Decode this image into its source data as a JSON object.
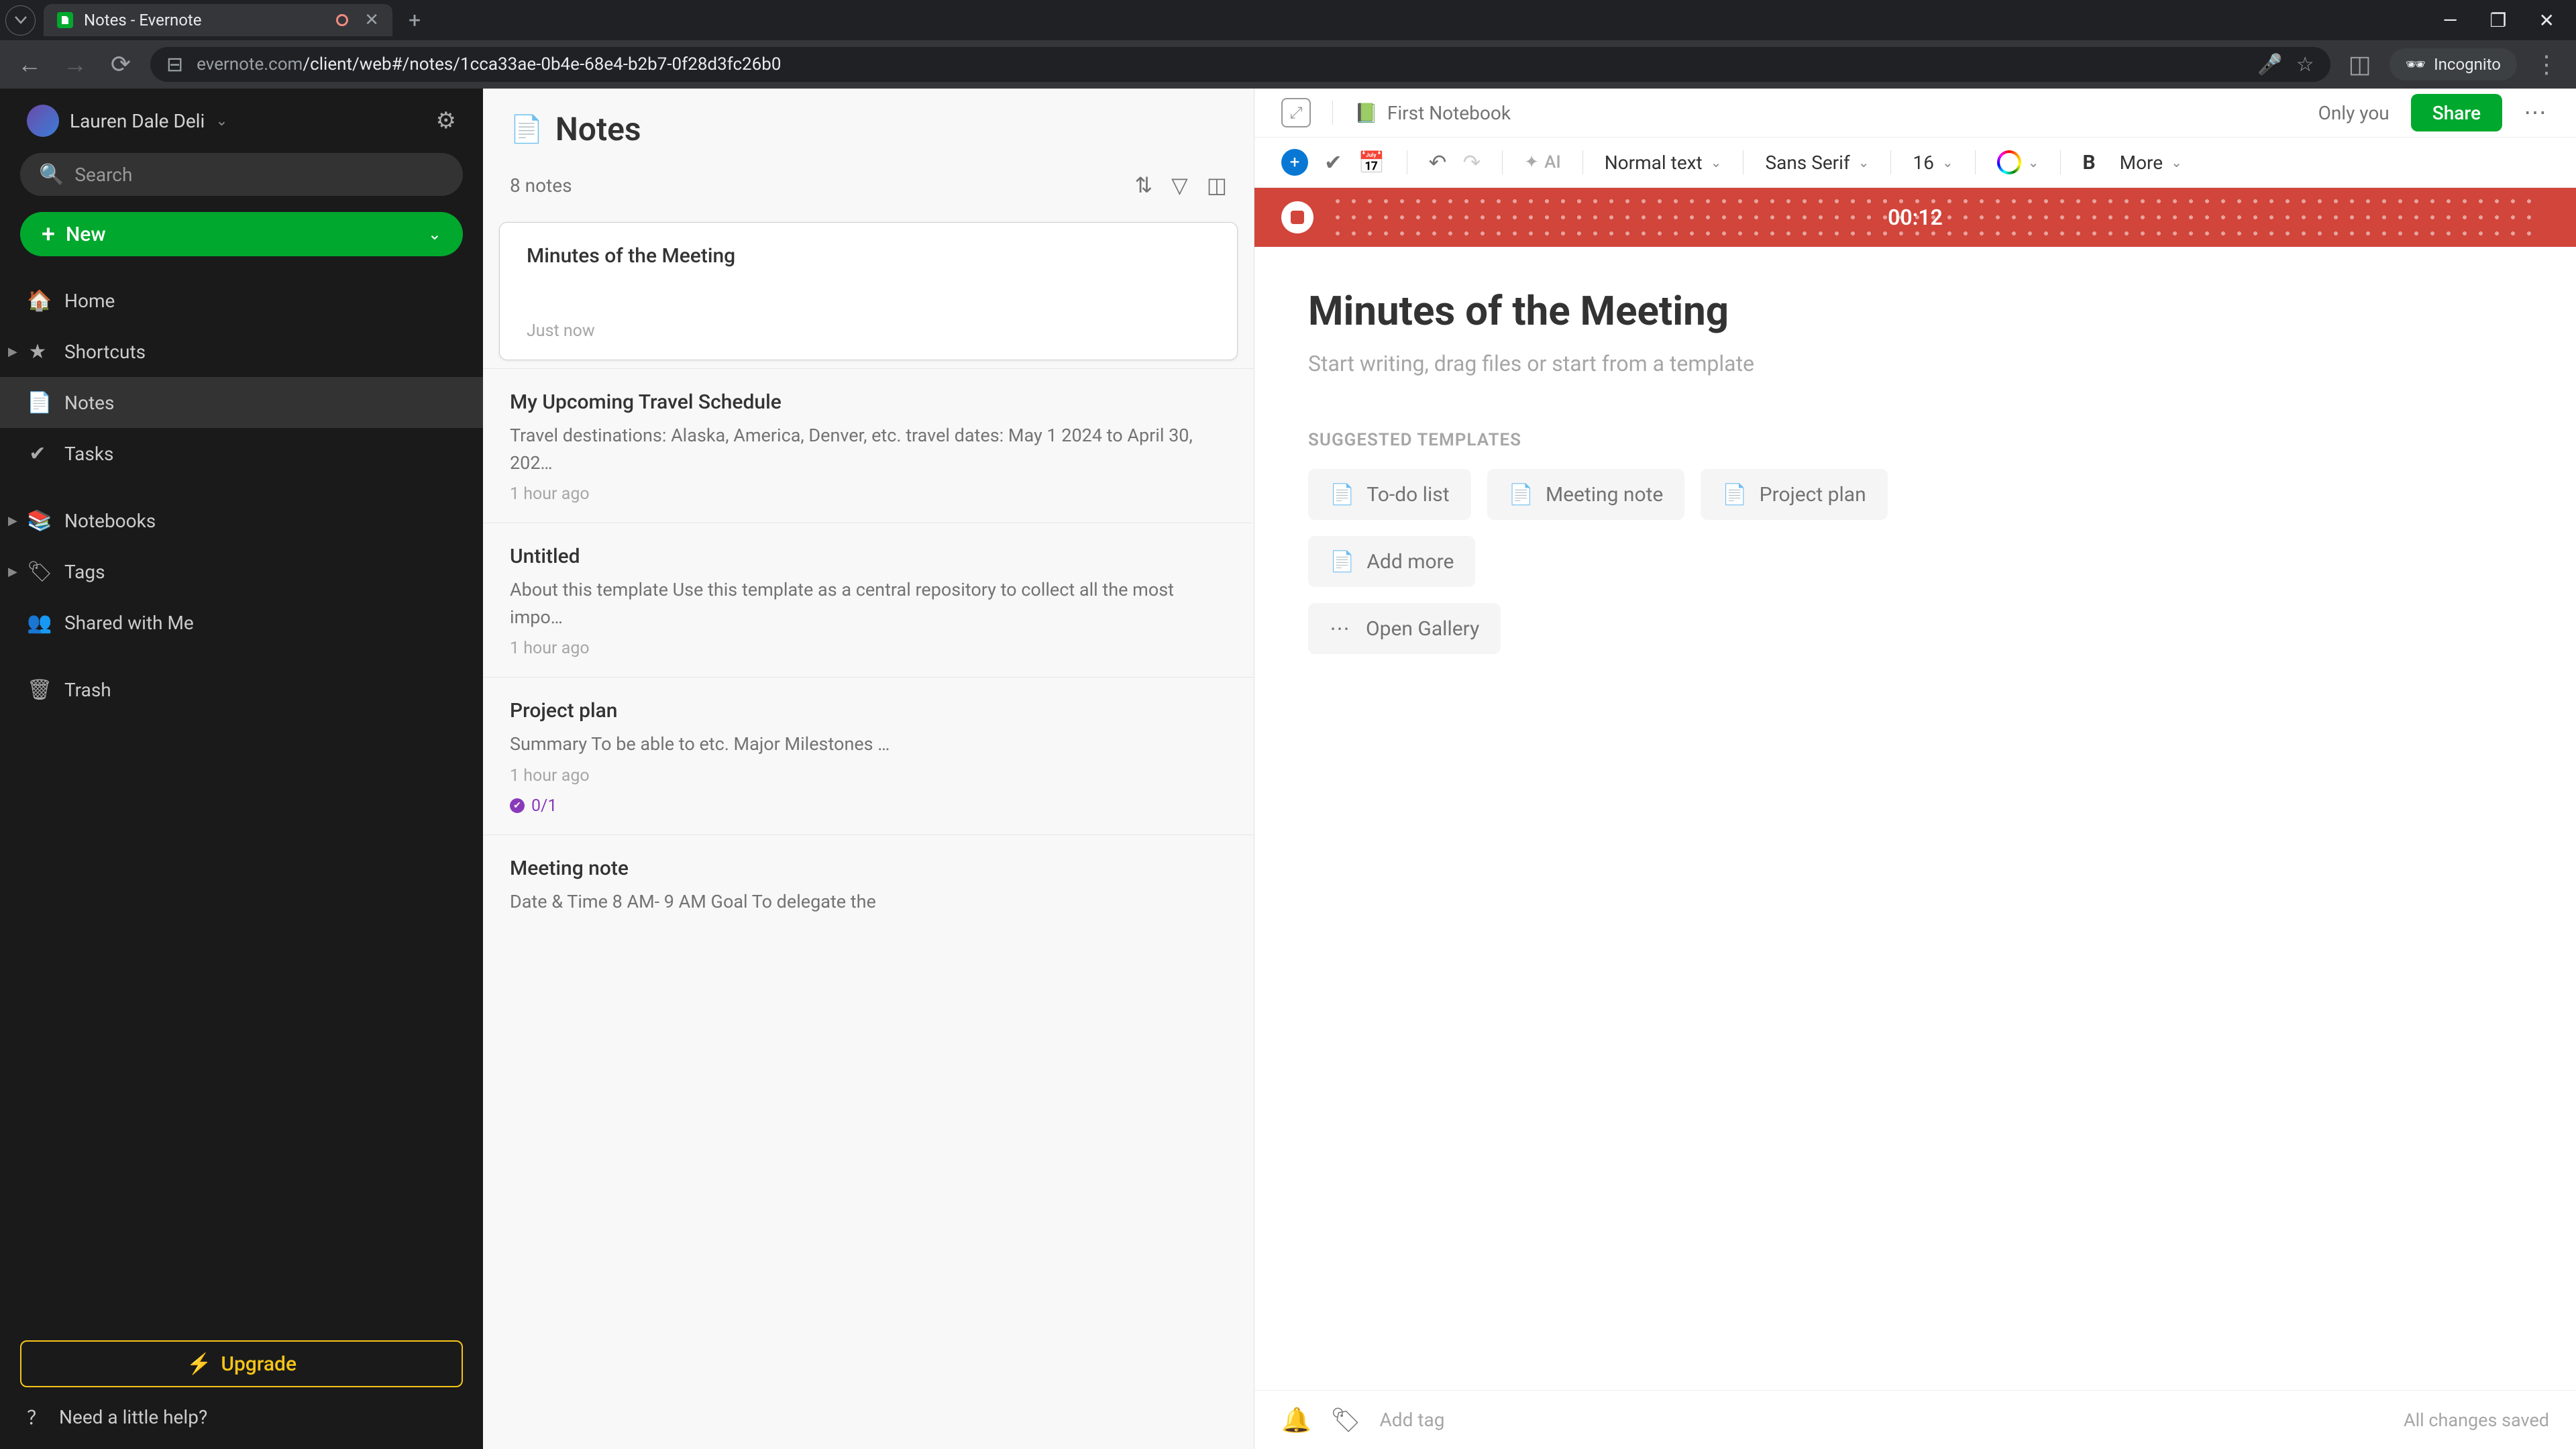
{
  "browser": {
    "tab_title": "Notes - Evernote",
    "url_display": "evernote.com/client/web#/notes/1cca33ae-0b4e-68e4-b2b7-0f28d3fc26b0",
    "incognito_label": "Incognito"
  },
  "sidebar": {
    "user_name": "Lauren Dale Deli",
    "search_placeholder": "Search",
    "new_label": "New",
    "items": [
      {
        "label": "Home",
        "icon": "home"
      },
      {
        "label": "Shortcuts",
        "icon": "star",
        "expandable": true
      },
      {
        "label": "Notes",
        "icon": "note",
        "active": true
      },
      {
        "label": "Tasks",
        "icon": "check"
      }
    ],
    "items2": [
      {
        "label": "Notebooks",
        "icon": "book",
        "expandable": true
      },
      {
        "label": "Tags",
        "icon": "tag",
        "expandable": true
      },
      {
        "label": "Shared with Me",
        "icon": "people"
      }
    ],
    "trash_label": "Trash",
    "upgrade_label": "Upgrade",
    "help_label": "Need a little help?"
  },
  "notelist": {
    "title": "Notes",
    "count_label": "8 notes",
    "notes": [
      {
        "title": "Minutes of the Meeting",
        "preview": "",
        "time": "Just now",
        "selected": true
      },
      {
        "title": "My Upcoming Travel Schedule",
        "preview": "Travel destinations: Alaska, America, Denver, etc. travel dates: May 1 2024 to April 30, 202…",
        "time": "1 hour ago"
      },
      {
        "title": "Untitled",
        "preview": "About this template Use this template as a central repository to collect all the most impo…",
        "time": "1 hour ago"
      },
      {
        "title": "Project plan",
        "preview": "Summary To be able to etc. Major Milestones …",
        "time": "1 hour ago",
        "task_badge": "0/1"
      },
      {
        "title": "Meeting note",
        "preview": "Date & Time 8 AM- 9 AM Goal To delegate the",
        "time": ""
      }
    ]
  },
  "editor": {
    "notebook_label": "First Notebook",
    "only_you": "Only you",
    "share_label": "Share",
    "ai_label": "AI",
    "text_style": "Normal text",
    "font_family": "Sans Serif",
    "font_size": "16",
    "more_label": "More",
    "recording_time": "00:12",
    "title": "Minutes of the Meeting",
    "placeholder": "Start writing, drag files or start from a template",
    "suggested_header": "SUGGESTED TEMPLATES",
    "templates": [
      "To-do list",
      "Meeting note",
      "Project plan"
    ],
    "add_more_label": "Add more",
    "gallery_label": "Open Gallery",
    "add_tag_placeholder": "Add tag",
    "save_status": "All changes saved"
  }
}
